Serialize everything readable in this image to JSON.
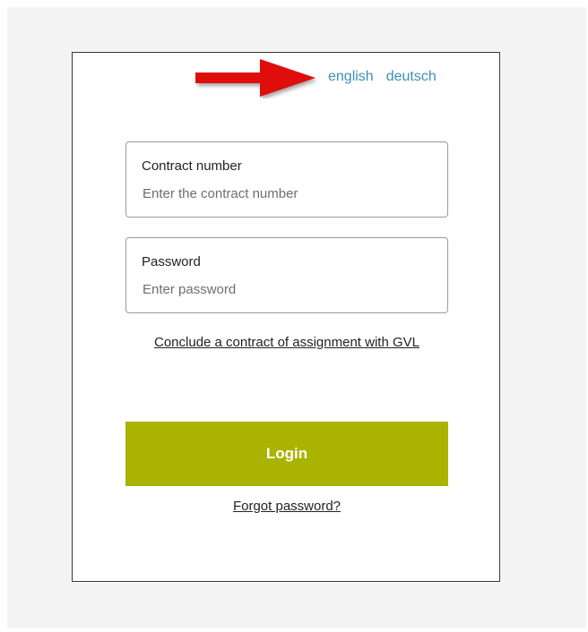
{
  "language_switch": {
    "english_label": "english",
    "deutsch_label": "deutsch"
  },
  "annotation": {
    "arrow_icon": "red-arrow-right-icon",
    "color": "#e01010"
  },
  "contract_field": {
    "label": "Contract number",
    "placeholder": "Enter the contract number",
    "value": ""
  },
  "password_field": {
    "label": "Password",
    "placeholder": "Enter password",
    "value": ""
  },
  "links": {
    "conclude_contract": "Conclude a contract of assignment with GVL",
    "forgot_password": "Forgot password?"
  },
  "login": {
    "label": "Login",
    "color": "#a9b300"
  },
  "colors": {
    "link": "#3a8fb7",
    "card_border": "#3a3a3a",
    "backdrop": "#f4f4f4"
  }
}
